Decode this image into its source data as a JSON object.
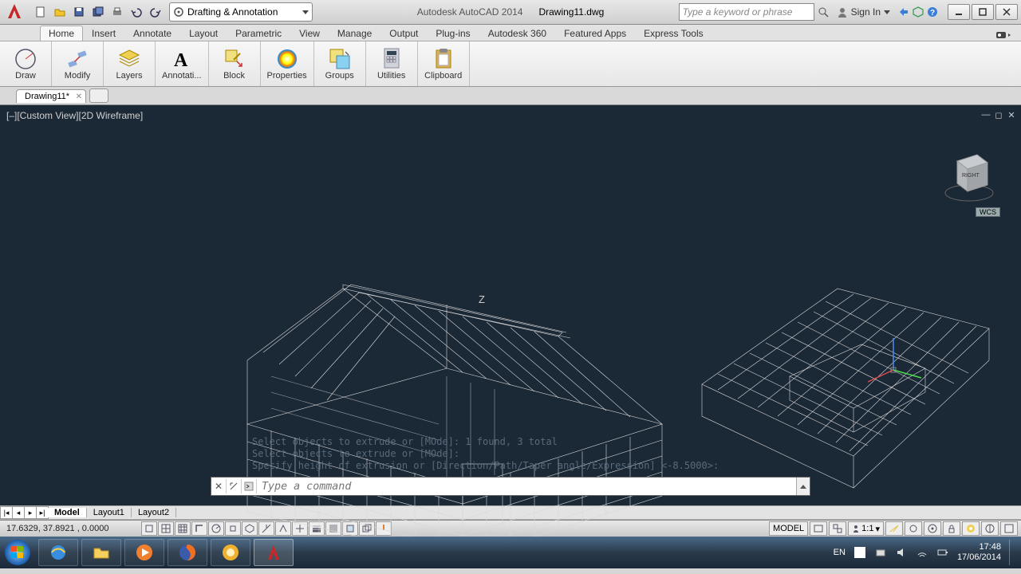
{
  "title": {
    "app": "Autodesk AutoCAD 2014",
    "doc": "Drawing11.dwg"
  },
  "workspace": "Drafting & Annotation",
  "search_placeholder": "Type a keyword or phrase",
  "signin": "Sign In",
  "menu_tabs": [
    "Home",
    "Insert",
    "Annotate",
    "Layout",
    "Parametric",
    "View",
    "Manage",
    "Output",
    "Plug-ins",
    "Autodesk 360",
    "Featured Apps",
    "Express Tools"
  ],
  "active_tab": "Home",
  "panels": [
    {
      "label": "Draw"
    },
    {
      "label": "Modify"
    },
    {
      "label": "Layers"
    },
    {
      "label": "Annotati..."
    },
    {
      "label": "Block"
    },
    {
      "label": "Properties"
    },
    {
      "label": "Groups"
    },
    {
      "label": "Utilities"
    },
    {
      "label": "Clipboard"
    }
  ],
  "doc_tab": "Drawing11*",
  "viewport_label": "[–][Custom View][2D Wireframe]",
  "viewcube_face": "RIGHT",
  "wcs_label": "WCS",
  "axis_z": "Z",
  "cmd_history": [
    "Select objects to extrude or [MOde]: 1 found, 3 total",
    "Select objects to extrude or [MOde]:",
    "Specify height of extrusion or [Direction/Path/Taper angle/Expression] <-8.5000>:"
  ],
  "cmd_placeholder": "Type a command",
  "layout_tabs": [
    "Model",
    "Layout1",
    "Layout2"
  ],
  "active_layout": "Model",
  "coords": "17.6329, 37.8921 , 0.0000",
  "status_right": {
    "model": "MODEL",
    "scale": "1:1"
  },
  "tray": {
    "lang": "EN",
    "time": "17:48",
    "date": "17/06/2014"
  }
}
